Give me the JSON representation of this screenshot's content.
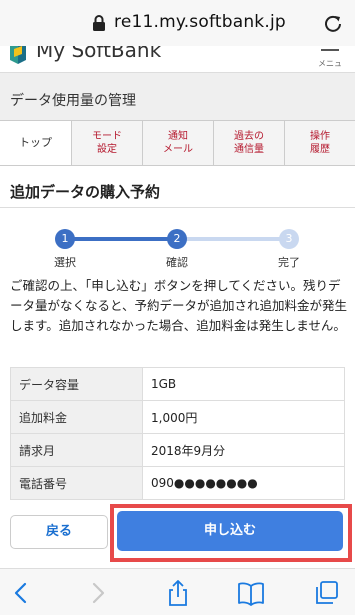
{
  "browser": {
    "url": "re11.my.softbank.jp",
    "lock_icon": "lock-icon",
    "reload_icon": "reload-icon"
  },
  "site": {
    "logo_text": "My SoftBank",
    "menu_label": "メニュー"
  },
  "page": {
    "title": "データ使用量の管理"
  },
  "tabs": [
    {
      "label": "トップ"
    },
    {
      "label": "モード\n設定"
    },
    {
      "label": "通知\nメール"
    },
    {
      "label": "過去の\n通信量"
    },
    {
      "label": "操作\n履歴"
    }
  ],
  "section": {
    "title": "追加データの購入予約"
  },
  "steps": [
    {
      "number": "1",
      "label": "選択"
    },
    {
      "number": "2",
      "label": "確認"
    },
    {
      "number": "3",
      "label": "完了"
    }
  ],
  "notice": "ご確認の上、「申し込む」ボタンを押してください。残りデータ量がなくなると、予約データが追加され追加料金が発生します。追加されなかった場合、追加料金は発生しません。",
  "details": [
    {
      "key": "データ容量",
      "value": "1GB"
    },
    {
      "key": "追加料金",
      "value": "1,000円"
    },
    {
      "key": "請求月",
      "value": "2018年9月分"
    },
    {
      "key": "電話番号",
      "value": "090●●●●●●●●"
    }
  ],
  "actions": {
    "back_label": "戻る",
    "apply_label": "申し込む"
  },
  "toolbar": {
    "icons": [
      "back-icon",
      "forward-icon",
      "share-icon",
      "bookmarks-icon",
      "tabs-icon"
    ]
  },
  "colors": {
    "accent_blue": "#3f7fe0",
    "step_blue": "#3c6fc4",
    "step_inactive": "#c9d8f0",
    "highlight_red": "#e74a4a",
    "tab_red": "#b5192e"
  }
}
